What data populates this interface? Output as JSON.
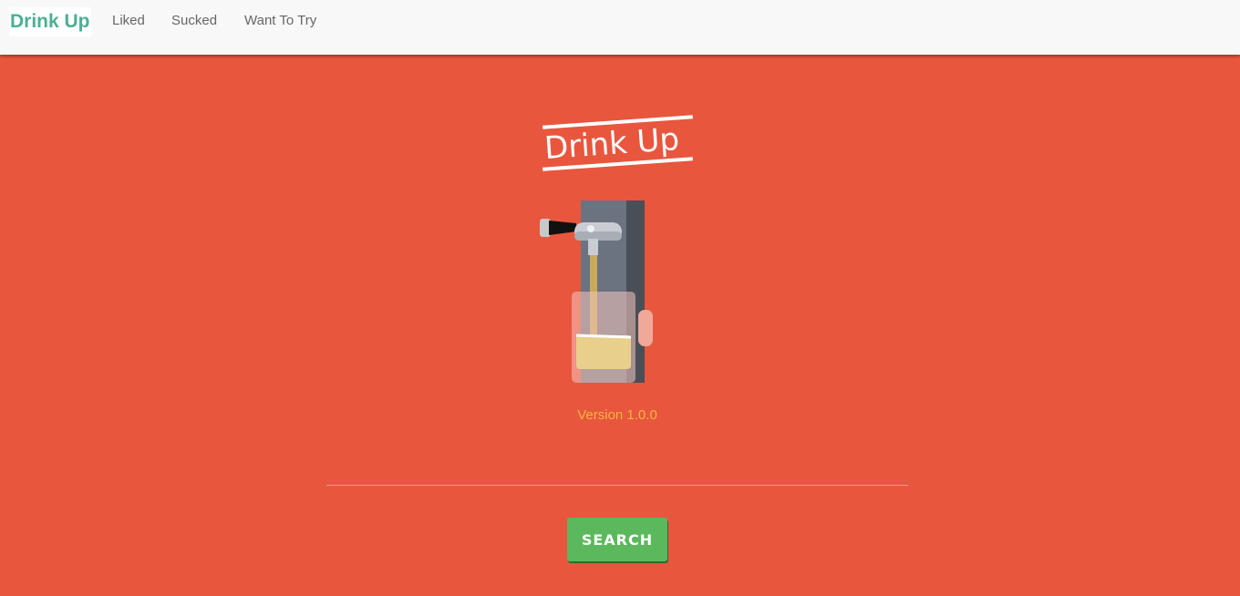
{
  "nav": {
    "brand": "Drink Up",
    "links": [
      "Liked",
      "Sucked",
      "Want To Try"
    ]
  },
  "hero": {
    "logo_text": "Drink Up",
    "version": "Version 1.0.0"
  },
  "search": {
    "value": "",
    "placeholder": "",
    "button_label": "SEARCH"
  },
  "colors": {
    "background": "#e8563e",
    "navbar": "#f8f8f8",
    "brand": "#4caf93",
    "version_text": "#f0b73c",
    "button": "#5cb85c",
    "beer": "#e8cf8c"
  },
  "icons": {
    "hero_illustration": "beer-tap-icon"
  }
}
